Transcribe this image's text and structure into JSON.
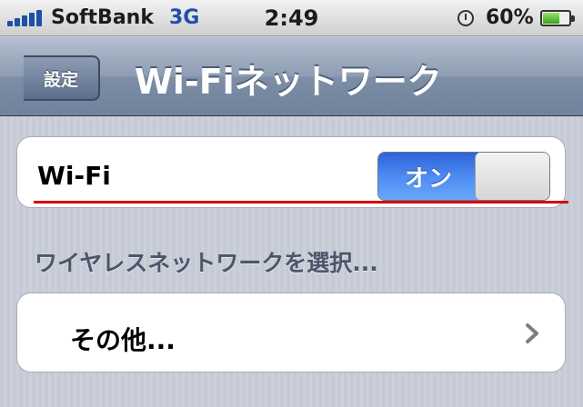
{
  "statusbar": {
    "carrier": "SoftBank",
    "network": "3G",
    "time": "2:49",
    "battery_percent": "60%",
    "battery_level": 0.6,
    "icons": [
      "signal-icon",
      "alarm-icon",
      "battery-icon"
    ]
  },
  "navbar": {
    "back_label": "設定",
    "title": "Wi-Fiネットワーク"
  },
  "wifi": {
    "label": "Wi-Fi",
    "toggle_label": "オン",
    "toggle_state": "on"
  },
  "section": {
    "header": "ワイヤレスネットワークを選択..."
  },
  "other": {
    "label": "その他..."
  },
  "colors": {
    "toggle_on": "#4f8ff4",
    "highlight_line": "#d40000"
  }
}
